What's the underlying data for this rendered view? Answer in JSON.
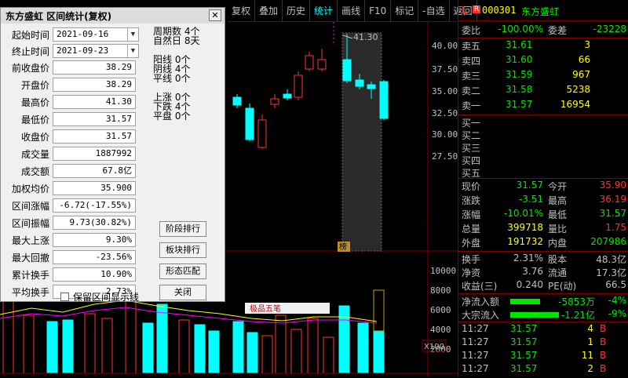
{
  "toolbar": {
    "items": [
      "复权",
      "叠加",
      "历史",
      "统计",
      "画线",
      "F10",
      "标记",
      "-自选",
      "返回"
    ]
  },
  "chart": {
    "y_labels": [
      "40.00",
      "37.50",
      "35.00",
      "32.50",
      "30.00",
      "27.50"
    ],
    "vol_labels": [
      "10000",
      "8000",
      "6000",
      "4000",
      "2000"
    ],
    "max_label": "41.30",
    "scale_label": "X100",
    "indicator_label": "极品五笔",
    "marker_label": "榜"
  },
  "dialog": {
    "title": "东方盛虹  区间统计(复权)",
    "start_label": "起始时间",
    "start_value": "2021-09-16",
    "end_label": "终止时间",
    "end_value": "2021-09-23",
    "rows": [
      {
        "label": "前收盘价",
        "value": "38.29"
      },
      {
        "label": "开盘价",
        "value": "38.29"
      },
      {
        "label": "最高价",
        "value": "41.30"
      },
      {
        "label": "最低价",
        "value": "31.57"
      },
      {
        "label": "收盘价",
        "value": "31.57"
      },
      {
        "label": "成交量",
        "value": "1887992"
      },
      {
        "label": "成交额",
        "value": "67.8亿"
      },
      {
        "label": "加权均价",
        "value": "35.900"
      },
      {
        "label": "区间涨幅",
        "value": "-6.72(-17.55%)"
      },
      {
        "label": "区间振幅",
        "value": "9.73(30.82%)"
      },
      {
        "label": "最大上涨",
        "value": "9.30%"
      },
      {
        "label": "最大回撤",
        "value": "-23.56%"
      },
      {
        "label": "累计换手",
        "value": "10.90%"
      },
      {
        "label": "平均换手",
        "value": "2.73%"
      }
    ],
    "stats": [
      {
        "label": "周期数",
        "value": "4个"
      },
      {
        "label": "自然日",
        "value": "8天"
      },
      {
        "label": "阳线",
        "value": "0个"
      },
      {
        "label": "阴线",
        "value": "4个"
      },
      {
        "label": "平线",
        "value": "0个"
      },
      {
        "label": "上涨",
        "value": "0个"
      },
      {
        "label": "下跌",
        "value": "4个"
      },
      {
        "label": "平盘",
        "value": "0个"
      }
    ],
    "buttons": [
      "阶段排行",
      "板块排行",
      "形态匹配",
      "关闭"
    ],
    "checkbox_label": "保留区间显示线"
  },
  "quote": {
    "code": "000301",
    "name": "东方盛虹",
    "weibi_label": "委比",
    "weibi_value": "-100.00%",
    "weicha_label": "委差",
    "weicha_value": "-23228",
    "asks": [
      {
        "label": "卖五",
        "price": "31.61",
        "vol": "3"
      },
      {
        "label": "卖四",
        "price": "31.60",
        "vol": "66"
      },
      {
        "label": "卖三",
        "price": "31.59",
        "vol": "967"
      },
      {
        "label": "卖二",
        "price": "31.58",
        "vol": "5238"
      },
      {
        "label": "卖一",
        "price": "31.57",
        "vol": "16954"
      }
    ],
    "bids": [
      {
        "label": "买一"
      },
      {
        "label": "买二"
      },
      {
        "label": "买三"
      },
      {
        "label": "买四"
      },
      {
        "label": "买五"
      }
    ],
    "stats": [
      {
        "l1": "现价",
        "v1": "31.57",
        "l2": "今开",
        "v2": "35.90"
      },
      {
        "l1": "涨跌",
        "v1": "-3.51",
        "l2": "最高",
        "v2": "36.19"
      },
      {
        "l1": "涨幅",
        "v1": "-10.01%",
        "l2": "最低",
        "v2": "31.57"
      },
      {
        "l1": "总量",
        "v1": "399718",
        "l2": "量比",
        "v2": "1.75"
      },
      {
        "l1": "外盘",
        "v1": "191732",
        "l2": "内盘",
        "v2": "207986"
      }
    ],
    "stats2": [
      {
        "l1": "换手",
        "v1": "2.31%",
        "l2": "股本",
        "v2": "48.3亿"
      },
      {
        "l1": "净资",
        "v1": "3.76",
        "l2": "流通",
        "v2": "17.3亿"
      },
      {
        "l1": "收益(三)",
        "v1": "0.240",
        "l2": "PE(动)",
        "v2": "66.5"
      }
    ],
    "flow": [
      {
        "label": "净流入额",
        "value": "-5853万",
        "pct": "-4%"
      },
      {
        "label": "大宗流入",
        "value": "-1.21亿",
        "pct": "-9%"
      }
    ],
    "ticks": [
      {
        "time": "11:27",
        "price": "31.57",
        "vol": "4",
        "dir": "B"
      },
      {
        "time": "11:27",
        "price": "31.57",
        "vol": "1",
        "dir": "B"
      },
      {
        "time": "11:27",
        "price": "31.57",
        "vol": "11",
        "dir": "B"
      },
      {
        "time": "11:27",
        "price": "31.57",
        "vol": "2",
        "dir": "B"
      }
    ],
    "colors": {
      "up": "#ff3232",
      "down": "#00e600",
      "neutral": "#c0c0c0",
      "label": "#c0c0c0",
      "yellow": "#ffff00"
    }
  }
}
